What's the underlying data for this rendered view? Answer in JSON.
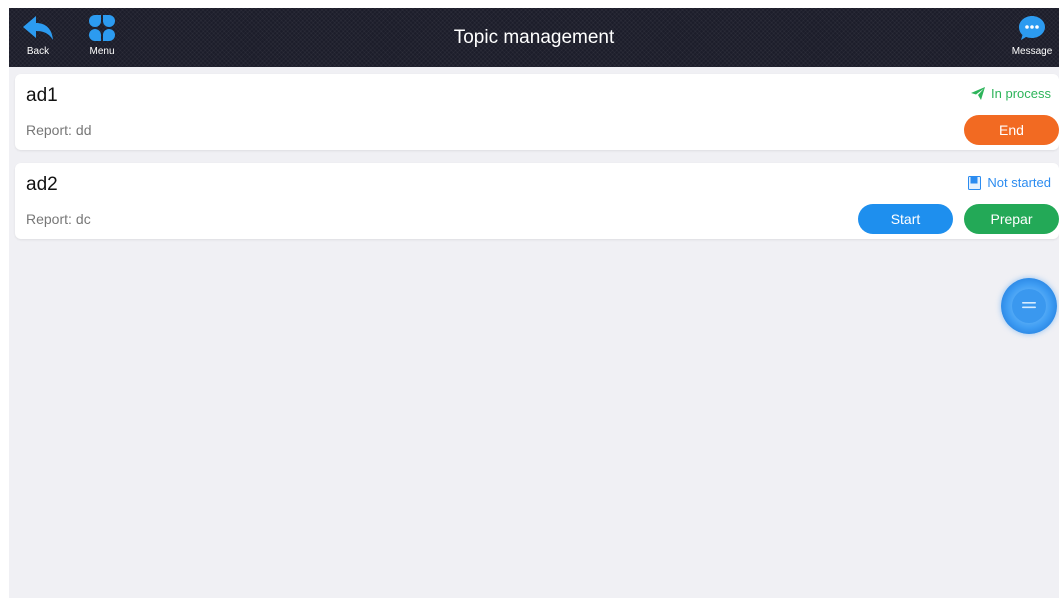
{
  "header": {
    "title": "Topic management",
    "back_label": "Back",
    "menu_label": "Menu",
    "message_label": "Message",
    "back_icon": "back-arrow-icon",
    "menu_icon": "four-petal-grid-icon",
    "message_icon": "chat-bubble-icon"
  },
  "report_label": "Report:",
  "topics": [
    {
      "name": "ad1",
      "report": "dd",
      "status": "In process",
      "status_icon": "paper-plane-icon",
      "status_color": "#2db45a",
      "actions": [
        {
          "label": "End",
          "color": "#f26a22"
        }
      ]
    },
    {
      "name": "ad2",
      "report": "dc",
      "status": "Not started",
      "status_icon": "document-icon",
      "status_color": "#2c8cf0",
      "actions": [
        {
          "label": "Start",
          "color": "#1e8fee"
        },
        {
          "label": "Prepar",
          "color": "#23a957"
        }
      ]
    }
  ],
  "floating_button": {
    "icon": "list-menu-icon",
    "color": "#3a98ef"
  },
  "colors": {
    "header_bg": "#1c1d2a",
    "page_bg": "#f0f0f4",
    "accent_blue": "#2c9bf0"
  }
}
